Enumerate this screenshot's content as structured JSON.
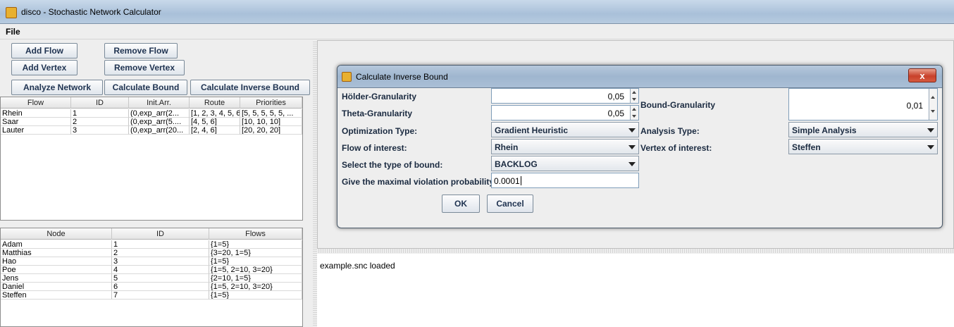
{
  "window": {
    "title": "disco - Stochastic Network Calculator"
  },
  "menu": {
    "file": "File"
  },
  "buttons": {
    "add_flow": "Add Flow",
    "remove_flow": "Remove Flow",
    "add_vertex": "Add Vertex",
    "remove_vertex": "Remove Vertex",
    "analyze_network": "Analyze Network",
    "calculate_bound": "Calculate Bound",
    "calculate_inverse_bound": "Calculate Inverse Bound"
  },
  "flows_table": {
    "headers": [
      "Flow",
      "ID",
      "Init.Arr.",
      "Route",
      "Priorities"
    ],
    "rows": [
      [
        "Rhein",
        "1",
        "(0,exp_arr(2...",
        "[1, 2, 3, 4, 5, 6...",
        "[5, 5, 5, 5, 5, ..."
      ],
      [
        "Saar",
        "2",
        "(0,exp_arr(5....",
        "[4, 5, 6]",
        "[10, 10, 10]"
      ],
      [
        "Lauter",
        "3",
        "(0,exp_arr(20...",
        "[2, 4, 6]",
        "[20, 20, 20]"
      ]
    ]
  },
  "nodes_table": {
    "headers": [
      "Node",
      "ID",
      "Flows"
    ],
    "rows": [
      [
        "Adam",
        "1",
        "{1=5}"
      ],
      [
        "Matthias",
        "2",
        "{3=20, 1=5}"
      ],
      [
        "Hao",
        "3",
        "{1=5}"
      ],
      [
        "Poe",
        "4",
        "{1=5, 2=10, 3=20}"
      ],
      [
        "Jens",
        "5",
        "{2=10, 1=5}"
      ],
      [
        "Daniel",
        "6",
        "{1=5, 2=10, 3=20}"
      ],
      [
        "Steffen",
        "7",
        "{1=5}"
      ]
    ]
  },
  "console": {
    "text": "example.snc loaded"
  },
  "dialog": {
    "title": "Calculate Inverse Bound",
    "close": "x",
    "holder_label": "Hölder-Granularity",
    "holder_value": "0,05",
    "theta_label": "Theta-Granularity",
    "theta_value": "0,05",
    "bound_label": "Bound-Granularity",
    "bound_value": "0,01",
    "opt_type_label": "Optimization Type:",
    "opt_type_value": "Gradient Heuristic",
    "analysis_type_label": "Analysis Type:",
    "analysis_type_value": "Simple Analysis",
    "flow_label": "Flow of interest:",
    "flow_value": "Rhein",
    "vertex_label": "Vertex of interest:",
    "vertex_value": "Steffen",
    "bound_type_label": "Select the type of bound:",
    "bound_type_value": "BACKLOG",
    "violation_label": "Give the maximal violation probability:",
    "violation_value": "0.0001",
    "ok": "OK",
    "cancel": "Cancel"
  }
}
